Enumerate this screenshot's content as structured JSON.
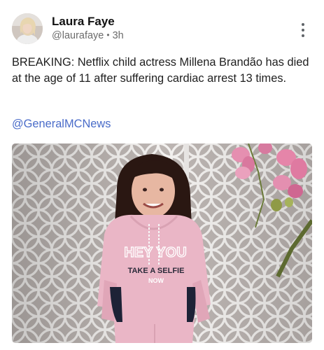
{
  "post": {
    "author": {
      "name": "Laura Faye",
      "handle": "@laurafaye",
      "separator": "•",
      "time": "3h"
    },
    "text": "BREAKING: Netflix child actress Millena Brandão has died at the age of 11 after suffering cardiac arrest 13 times.",
    "mention": "@GeneralMCNews",
    "image": {
      "sweater_text_line1": "HEY YOU",
      "sweater_text_line2": "TAKE A SELFIE",
      "sweater_text_line3": "NOW"
    }
  },
  "icons": {
    "more": "more-vertical-icon"
  },
  "colors": {
    "link": "#4a6cc9",
    "meta": "#6b6b6b",
    "sweater": "#eab6c6"
  }
}
